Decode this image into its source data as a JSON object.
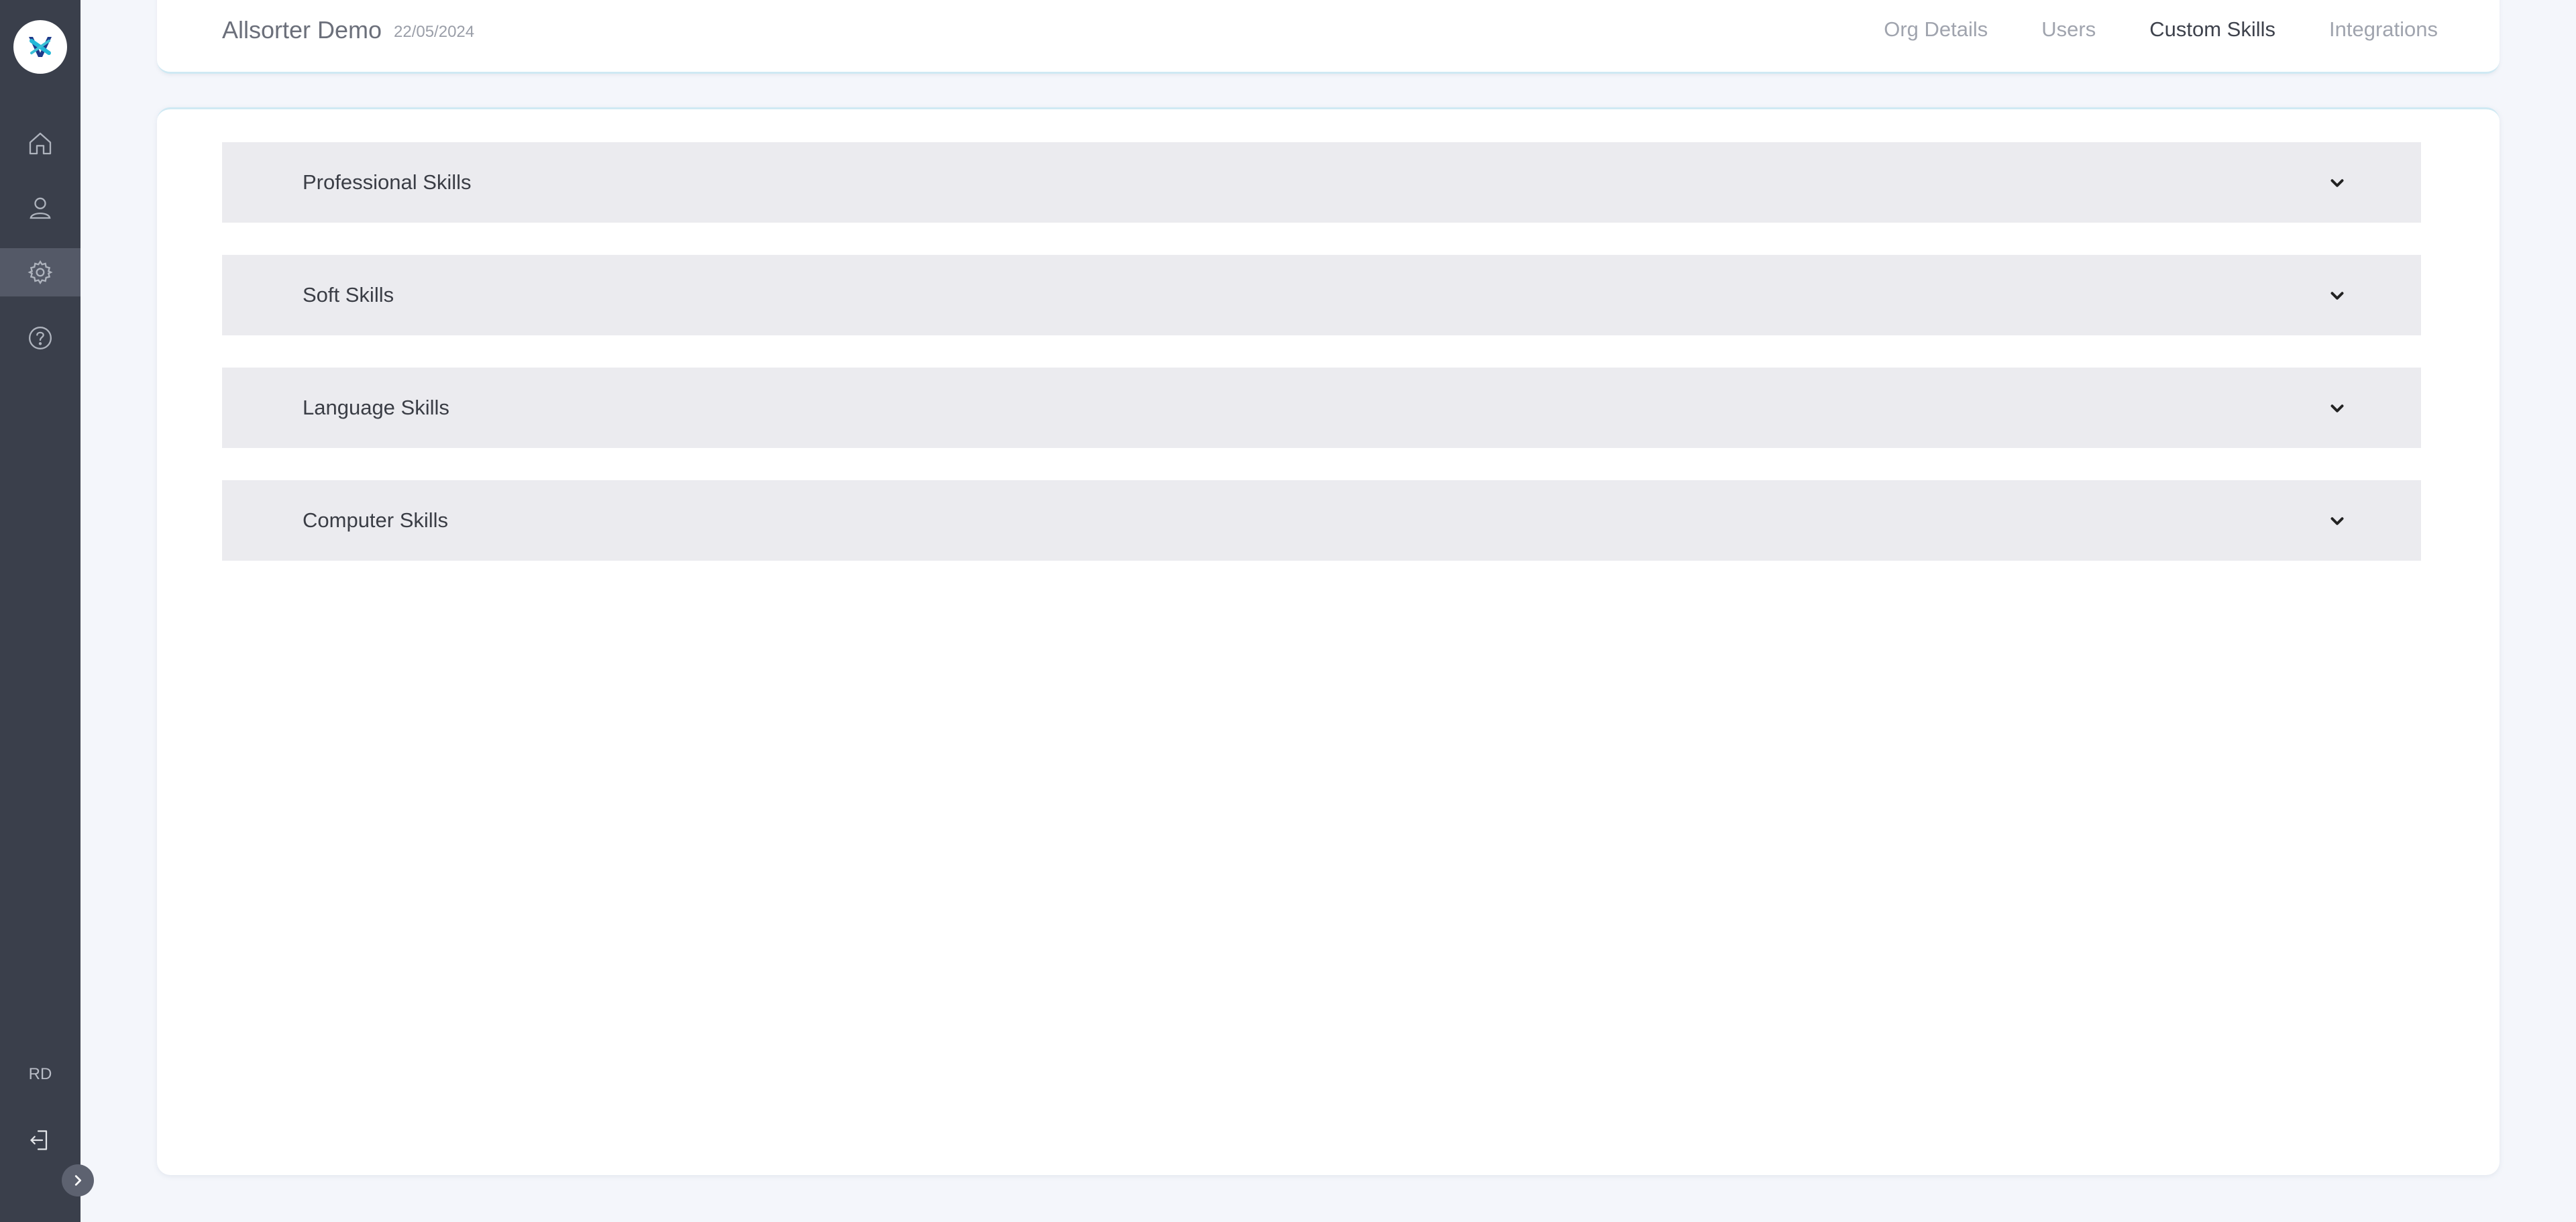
{
  "sidebar": {
    "logo_icon": "brand-logo-icon",
    "items": [
      {
        "icon": "home-icon",
        "label": "Home",
        "active": false
      },
      {
        "icon": "user-icon",
        "label": "Profile",
        "active": false
      },
      {
        "icon": "gear-icon",
        "label": "Settings",
        "active": true
      },
      {
        "icon": "help-icon",
        "label": "Help",
        "active": false
      }
    ],
    "user_initials": "RD",
    "logout_icon": "logout-icon",
    "expand_icon": "chevron-right-icon"
  },
  "header": {
    "org_name": "Allsorter Demo",
    "date": "22/05/2024",
    "tabs": [
      {
        "label": "Org Details",
        "active": false
      },
      {
        "label": "Users",
        "active": false
      },
      {
        "label": "Custom Skills",
        "active": true
      },
      {
        "label": "Integrations",
        "active": false
      }
    ]
  },
  "skills": {
    "sections": [
      {
        "label": "Professional Skills",
        "expanded": false
      },
      {
        "label": "Soft Skills",
        "expanded": false
      },
      {
        "label": "Language Skills",
        "expanded": false
      },
      {
        "label": "Computer Skills",
        "expanded": false
      }
    ]
  },
  "colors": {
    "sidebar_bg": "#3a3f4b",
    "sidebar_active": "#545967",
    "page_bg": "#f4f6fb",
    "accent_border": "#cfe9f3",
    "accordion_bg": "#ebebef"
  }
}
